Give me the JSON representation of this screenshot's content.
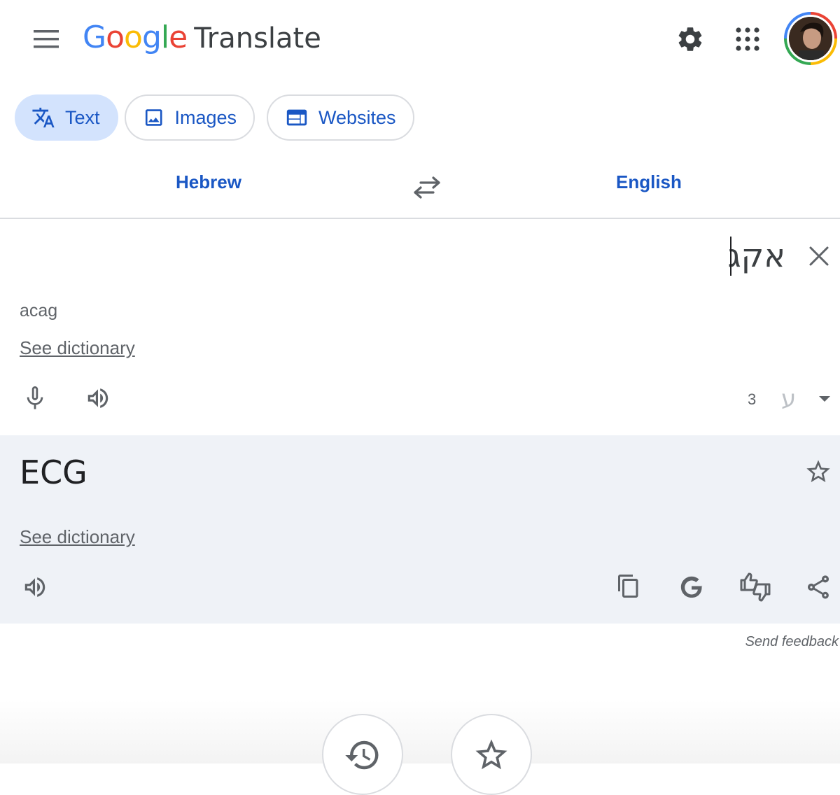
{
  "header": {
    "logo_letters": [
      {
        "char": "G",
        "color": "#4285f4"
      },
      {
        "char": "o",
        "color": "#ea4335"
      },
      {
        "char": "o",
        "color": "#fbbc05"
      },
      {
        "char": "g",
        "color": "#4285f4"
      },
      {
        "char": "l",
        "color": "#34a853"
      },
      {
        "char": "e",
        "color": "#ea4335"
      }
    ],
    "product": "Translate",
    "icons": [
      "menu-icon",
      "gear-icon",
      "apps-grid-icon",
      "avatar"
    ]
  },
  "modes": [
    {
      "label": "Text",
      "icon": "translate-icon",
      "active": true
    },
    {
      "label": "Images",
      "icon": "image-icon",
      "active": false
    },
    {
      "label": "Websites",
      "icon": "website-icon",
      "active": false
    }
  ],
  "languages": {
    "source": "Hebrew",
    "target": "English"
  },
  "source": {
    "text": "אקג",
    "transliteration": "acag",
    "dictionary_link": "See dictionary",
    "char_count": "3",
    "keyboard_letter": "ע"
  },
  "target": {
    "text": "ECG",
    "dictionary_link": "See dictionary"
  },
  "footer": {
    "feedback": "Send feedback"
  },
  "colors": {
    "accent": "#1a57c4",
    "chip_active_bg": "#d3e3fd",
    "target_panel_bg": "#eff2f7",
    "icon_gray": "#5f6368"
  }
}
